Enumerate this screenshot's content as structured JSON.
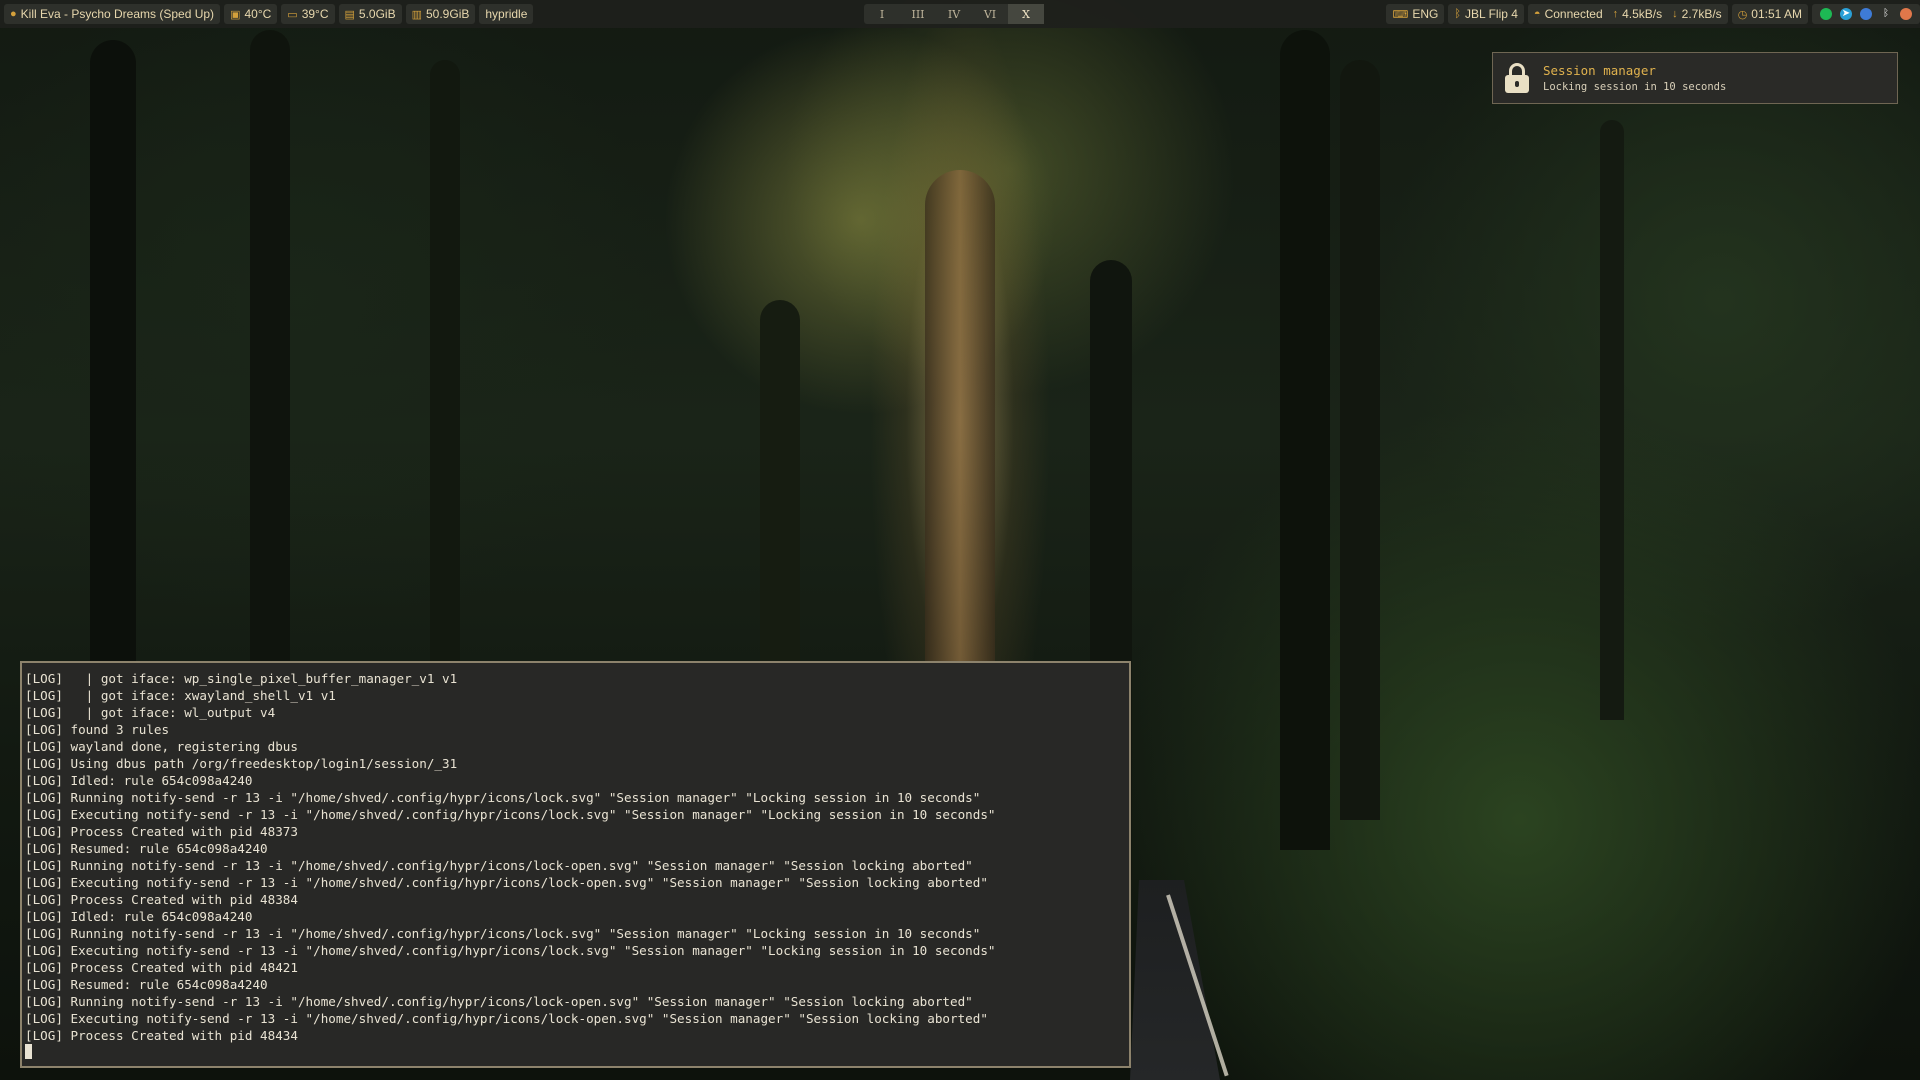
{
  "topbar": {
    "media": {
      "icon": "spotify-icon",
      "text": "Kill Eva - Psycho Dreams (Sped Up)"
    },
    "cpu_temp": {
      "icon": "cpu-icon",
      "text": "40°C"
    },
    "gpu_temp": {
      "icon": "monitor-icon",
      "text": "39°C"
    },
    "memory": {
      "icon": "memory-icon",
      "text": "5.0GiB"
    },
    "disk": {
      "icon": "disk-icon",
      "text": "50.9GiB"
    },
    "idle_daemon": {
      "text": "hypridle"
    },
    "workspaces": [
      {
        "label": "I",
        "active": false
      },
      {
        "label": "III",
        "active": false
      },
      {
        "label": "IV",
        "active": false
      },
      {
        "label": "VI",
        "active": false
      },
      {
        "label": "X",
        "active": true
      }
    ],
    "keyboard": {
      "icon": "keyboard-icon",
      "text": "ENG"
    },
    "bluetooth": {
      "icon": "bluetooth-icon",
      "text": "JBL Flip 4"
    },
    "network": {
      "icon": "network-icon",
      "text": "Connected",
      "up": "4.5kB/s",
      "down": "2.7kB/s"
    },
    "clock": {
      "icon": "clock-icon",
      "text": "01:51 AM"
    },
    "tray": [
      "spotify-icon",
      "telegram-icon",
      "browser-icon",
      "bluetooth-icon",
      "app-icon"
    ],
    "colors": {
      "accent": "#d4a03b",
      "bar_bg": "#1e1f1c",
      "module_bg": "#2e302b",
      "text": "#e7d7ad"
    }
  },
  "notification": {
    "icon": "lock-icon",
    "title": "Session manager",
    "body": "Locking session in 10 seconds"
  },
  "terminal": {
    "lines": [
      "[LOG]   | got iface: wp_single_pixel_buffer_manager_v1 v1",
      "[LOG]   | got iface: xwayland_shell_v1 v1",
      "[LOG]   | got iface: wl_output v4",
      "[LOG] found 3 rules",
      "[LOG] wayland done, registering dbus",
      "[LOG] Using dbus path /org/freedesktop/login1/session/_31",
      "[LOG] Idled: rule 654c098a4240",
      "[LOG] Running notify-send -r 13 -i \"/home/shved/.config/hypr/icons/lock.svg\" \"Session manager\" \"Locking session in 10 seconds\"",
      "[LOG] Executing notify-send -r 13 -i \"/home/shved/.config/hypr/icons/lock.svg\" \"Session manager\" \"Locking session in 10 seconds\"",
      "[LOG] Process Created with pid 48373",
      "[LOG] Resumed: rule 654c098a4240",
      "[LOG] Running notify-send -r 13 -i \"/home/shved/.config/hypr/icons/lock-open.svg\" \"Session manager\" \"Session locking aborted\"",
      "[LOG] Executing notify-send -r 13 -i \"/home/shved/.config/hypr/icons/lock-open.svg\" \"Session manager\" \"Session locking aborted\"",
      "[LOG] Process Created with pid 48384",
      "[LOG] Idled: rule 654c098a4240",
      "[LOG] Running notify-send -r 13 -i \"/home/shved/.config/hypr/icons/lock.svg\" \"Session manager\" \"Locking session in 10 seconds\"",
      "[LOG] Executing notify-send -r 13 -i \"/home/shved/.config/hypr/icons/lock.svg\" \"Session manager\" \"Locking session in 10 seconds\"",
      "[LOG] Process Created with pid 48421",
      "[LOG] Resumed: rule 654c098a4240",
      "[LOG] Running notify-send -r 13 -i \"/home/shved/.config/hypr/icons/lock-open.svg\" \"Session manager\" \"Session locking aborted\"",
      "[LOG] Executing notify-send -r 13 -i \"/home/shved/.config/hypr/icons/lock-open.svg\" \"Session manager\" \"Session locking aborted\"",
      "[LOG] Process Created with pid 48434"
    ]
  }
}
